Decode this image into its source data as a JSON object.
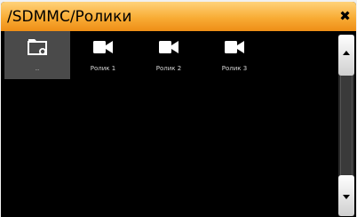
{
  "window": {
    "title": "/SDMMC/Ролики",
    "close_glyph": "✖"
  },
  "items": [
    {
      "label": "..",
      "icon": "folder-up-icon",
      "selected": true
    },
    {
      "label": "Ролик 1",
      "icon": "video-camera-icon"
    },
    {
      "label": "Ролик 2",
      "icon": "video-camera-icon"
    },
    {
      "label": "Ролик 3",
      "icon": "video-camera-icon"
    }
  ],
  "colors": {
    "title_bar_top": "#ffd27a",
    "title_bar_bottom": "#ee8e16",
    "background": "#000000",
    "selected_item": "#4a4a4a",
    "icon": "#ffffff",
    "label": "#d8d8d8"
  }
}
